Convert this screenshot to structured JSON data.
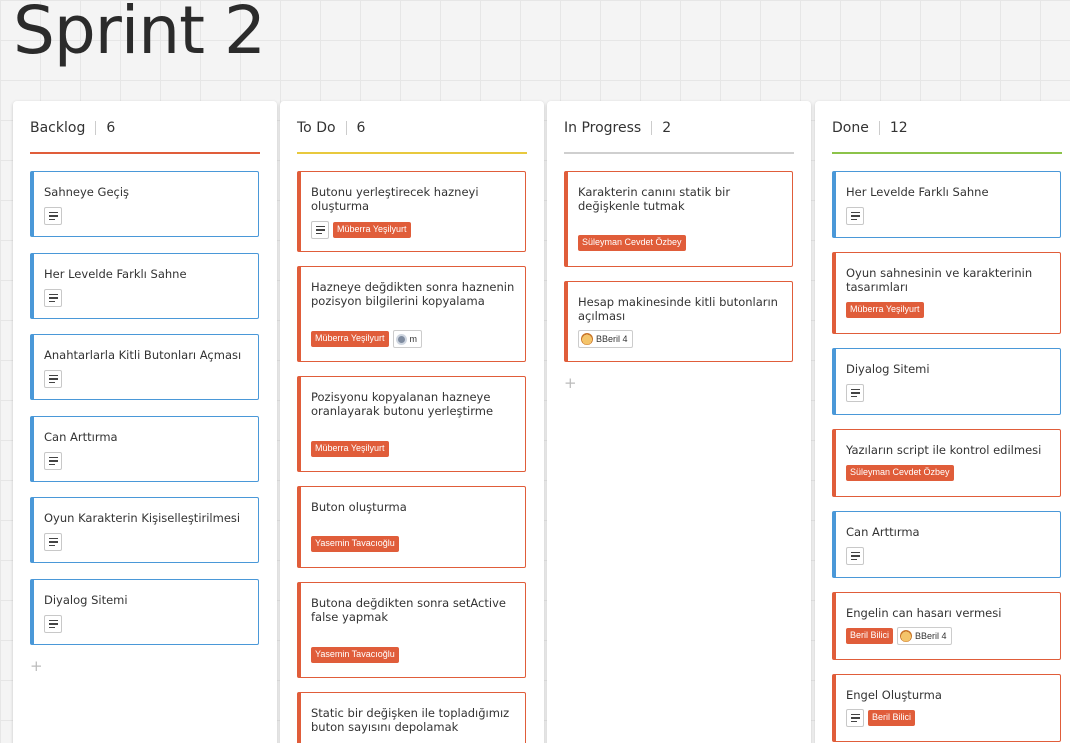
{
  "board": {
    "title": "Sprint 2"
  },
  "add_label": "+",
  "colors": {
    "backlog": "#e05d3a",
    "todo": "#e8c93e",
    "in_progress": "#cfcfcf",
    "done": "#8cc34a",
    "card_blue": "#4a98d8",
    "card_red": "#e05d3a"
  },
  "columns": [
    {
      "name": "Backlog",
      "count": "6",
      "cards": [
        {
          "title": "Sahneye Geçiş",
          "has_description": true
        },
        {
          "title": "Her Levelde Farklı Sahne",
          "has_description": true
        },
        {
          "title": "Anahtarlarla Kitli Butonları Açması",
          "has_description": true
        },
        {
          "title": "Can Arttırma",
          "has_description": true
        },
        {
          "title": "Oyun Karakterin Kişiselleştirilmesi",
          "has_description": true
        },
        {
          "title": "Diyalog Sitemi",
          "has_description": true
        }
      ]
    },
    {
      "name": "To Do",
      "count": "6",
      "cards": [
        {
          "title": "Butonu yerleştirecek hazneyi oluşturma",
          "has_description": true,
          "tag": "Müberra Yeşilyurt"
        },
        {
          "title": "Hazneye değdikten sonra haznenin pozisyon bilgilerini kopyalama",
          "tag": "Müberra Yeşilyurt",
          "user": "m",
          "user_avatar": "gray-avatar-icon"
        },
        {
          "title": "Pozisyonu kopyalanan hazneye oranlayarak butonu yerleştirme",
          "tag": "Müberra Yeşilyurt"
        },
        {
          "title": "Buton oluşturma",
          "tag": "Yasemin Tavacıoğlu"
        },
        {
          "title": "Butona değdikten sonra setActive false yapmak",
          "tag": "Yasemin Tavacıoğlu"
        },
        {
          "title": "Static bir değişken ile topladığımız buton sayısını depolamak"
        }
      ]
    },
    {
      "name": "In Progress",
      "count": "2",
      "cards": [
        {
          "title": "Karakterin canını statik bir değişkenle tutmak",
          "tag": "Süleyman Cevdet Özbey"
        },
        {
          "title": "Hesap makinesinde kitli butonların açılması",
          "user": "BBeril 4",
          "user_avatar": "emoji-avatar-icon"
        }
      ]
    },
    {
      "name": "Done",
      "count": "12",
      "cards": [
        {
          "title": "Her Levelde Farklı Sahne",
          "has_description": true
        },
        {
          "title": "Oyun sahnesinin ve karakterinin tasarımları",
          "tag": "Müberra Yeşilyurt"
        },
        {
          "title": "Diyalog Sitemi",
          "has_description": true
        },
        {
          "title": "Yazıların script ile kontrol edilmesi",
          "tag": "Süleyman Cevdet Özbey"
        },
        {
          "title": "Can Arttırma",
          "has_description": true
        },
        {
          "title": "Engelin can hasarı vermesi",
          "tag": "Beril Bilici",
          "user": "BBeril 4",
          "user_avatar": "emoji-avatar-icon"
        },
        {
          "title": "Engel Oluşturma",
          "has_description": true,
          "tag": "Beril Bilici"
        }
      ]
    }
  ]
}
